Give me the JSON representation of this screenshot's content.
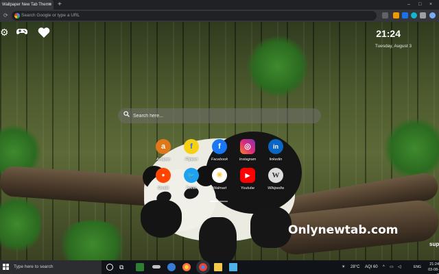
{
  "browser": {
    "tab_title": "Wallpaper New Tab Theme",
    "tab_close": "×",
    "new_tab": "+",
    "window_controls": [
      "–",
      "□",
      "×"
    ],
    "omnibox_placeholder": "Search Google or type a URL",
    "nav_icons": [
      "back-icon",
      "forward-icon",
      "reload-icon"
    ]
  },
  "newtab": {
    "time": "21:24",
    "date": "Tuesday, August 3",
    "search_placeholder": "Search here...",
    "top_icons": [
      "gear-icon",
      "gamepad-icon",
      "heart-icon"
    ],
    "shortcuts": [
      {
        "label": "Amazon",
        "glyph": "a",
        "color": "#e0771a"
      },
      {
        "label": "Flipkart",
        "glyph": "f",
        "color": "#2874f0"
      },
      {
        "label": "Facebook",
        "glyph": "f",
        "color": "#1877f2"
      },
      {
        "label": "Instagram",
        "glyph": "◎",
        "color": "#d6249f"
      },
      {
        "label": "linkedin",
        "glyph": "in",
        "color": "#0a66c2"
      },
      {
        "label": "Reddit",
        "glyph": "●",
        "color": "#ff4500"
      },
      {
        "label": "Twitter",
        "glyph": "🐦",
        "color": "#1da1f2"
      },
      {
        "label": "Walmart",
        "glyph": "✳",
        "color": "#ffffff"
      },
      {
        "label": "Youtube",
        "glyph": "▶",
        "color": "#ff0000"
      },
      {
        "label": "Wikipedia",
        "glyph": "W",
        "color": "#dcdcdc"
      }
    ],
    "watermark": "Onlynewtab.com",
    "corner_text": "sup"
  },
  "taskbar": {
    "search_placeholder": "Type here to search",
    "weather": "28°C",
    "aqi": "AQI 60",
    "language": "ENG",
    "time": "21:24",
    "date": "03-08-2"
  }
}
